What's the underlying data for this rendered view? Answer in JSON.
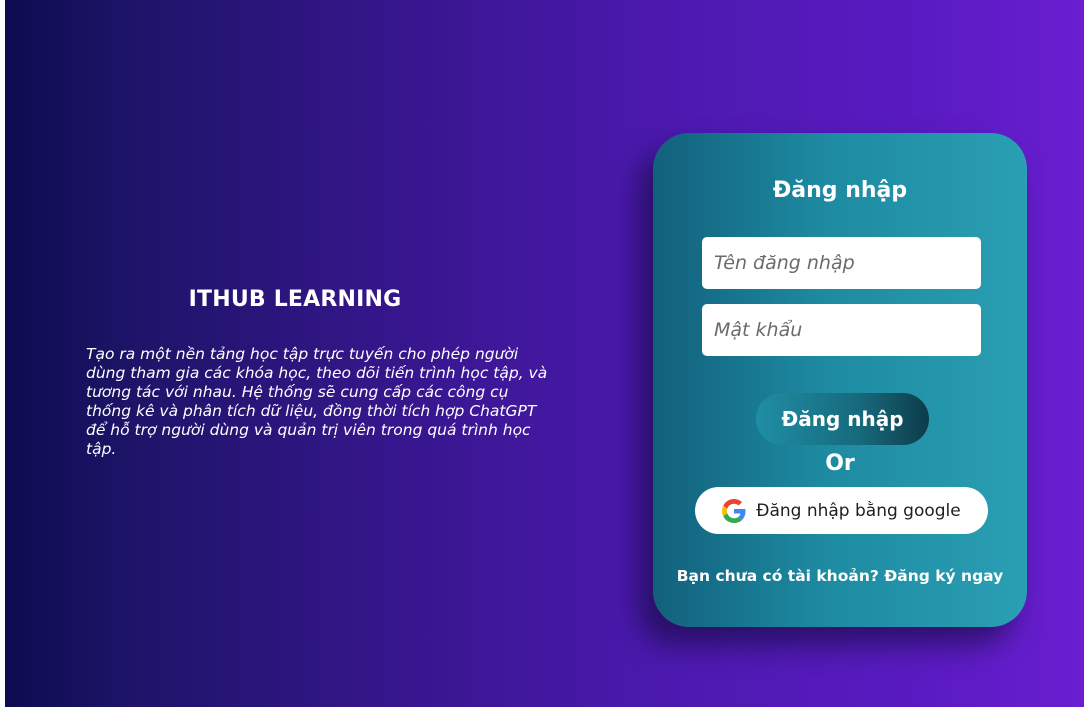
{
  "brand": {
    "title": "ITHUB LEARNING",
    "description": "Tạo ra một nền tảng học tập trực tuyến cho phép người dùng tham gia các khóa học,  theo dõi tiến trình học tập, và tương tác với nhau. Hệ thống sẽ cung cấp các công cụ  thống kê và phân tích dữ liệu, đồng thời tích hợp ChatGPT để hỗ trợ người dùng và quản trị viên  trong quá trình học tập."
  },
  "login": {
    "title": "Đăng nhập",
    "username_placeholder": "Tên đăng nhập",
    "password_placeholder": "Mật khẩu",
    "submit_label": "Đăng nhập",
    "or_label": "Or",
    "google_label": "Đăng nhập bằng google",
    "no_account_text": "Bạn chưa có tài khoản?",
    "signup_link": "Đăng ký ngay"
  },
  "icons": {
    "google": "google-icon"
  },
  "colors": {
    "background_start": "#0d0b4f",
    "background_end": "#6a1ed0",
    "card_start": "#12607c",
    "card_end": "#2a9fb3",
    "google_blue": "#4285F4",
    "google_red": "#EA4335",
    "google_yellow": "#FBBC05",
    "google_green": "#34A853"
  }
}
